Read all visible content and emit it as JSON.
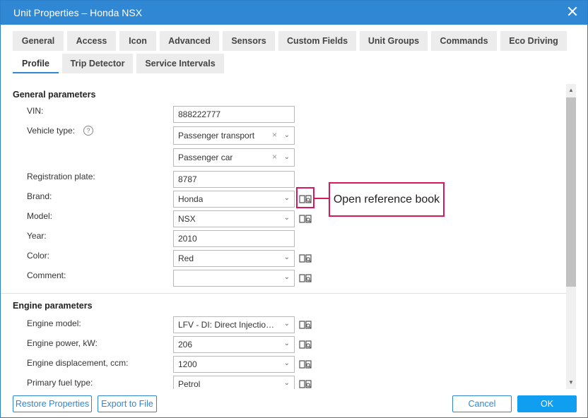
{
  "window": {
    "title": "Unit Properties – Honda NSX"
  },
  "tabs": [
    {
      "label": "General"
    },
    {
      "label": "Access"
    },
    {
      "label": "Icon"
    },
    {
      "label": "Advanced"
    },
    {
      "label": "Sensors"
    },
    {
      "label": "Custom Fields"
    },
    {
      "label": "Unit Groups"
    },
    {
      "label": "Commands"
    },
    {
      "label": "Eco Driving"
    },
    {
      "label": "Profile",
      "active": true
    },
    {
      "label": "Trip Detector"
    },
    {
      "label": "Service Intervals"
    }
  ],
  "general": {
    "title": "General parameters",
    "vin": {
      "label": "VIN:",
      "value": "888222777"
    },
    "vehicle_type": {
      "label": "Vehicle type:",
      "value1": "Passenger transport",
      "value2": "Passenger car",
      "help": "?"
    },
    "registration_plate": {
      "label": "Registration plate:",
      "value": "8787"
    },
    "brand": {
      "label": "Brand:",
      "value": "Honda"
    },
    "model": {
      "label": "Model:",
      "value": "NSX"
    },
    "year": {
      "label": "Year:",
      "value": "2010"
    },
    "color": {
      "label": "Color:",
      "value": "Red"
    },
    "comment": {
      "label": "Comment:",
      "value": ""
    }
  },
  "engine": {
    "title": "Engine parameters",
    "model": {
      "label": "Engine model:",
      "value": "LFV - DI: Direct Injection..."
    },
    "power": {
      "label": "Engine power, kW:",
      "value": "206"
    },
    "displacement": {
      "label": "Engine displacement, ccm:",
      "value": "1200"
    },
    "fuel": {
      "label": "Primary fuel type:",
      "value": "Petrol"
    }
  },
  "callout": {
    "text": "Open reference book"
  },
  "footer": {
    "restore": "Restore Properties",
    "export": "Export to File",
    "cancel": "Cancel",
    "ok": "OK"
  },
  "colors": {
    "titlebar": "#3088d4",
    "accent": "#2f86d1",
    "ok_button": "#0f9ef0",
    "callout": "#d7195a"
  }
}
